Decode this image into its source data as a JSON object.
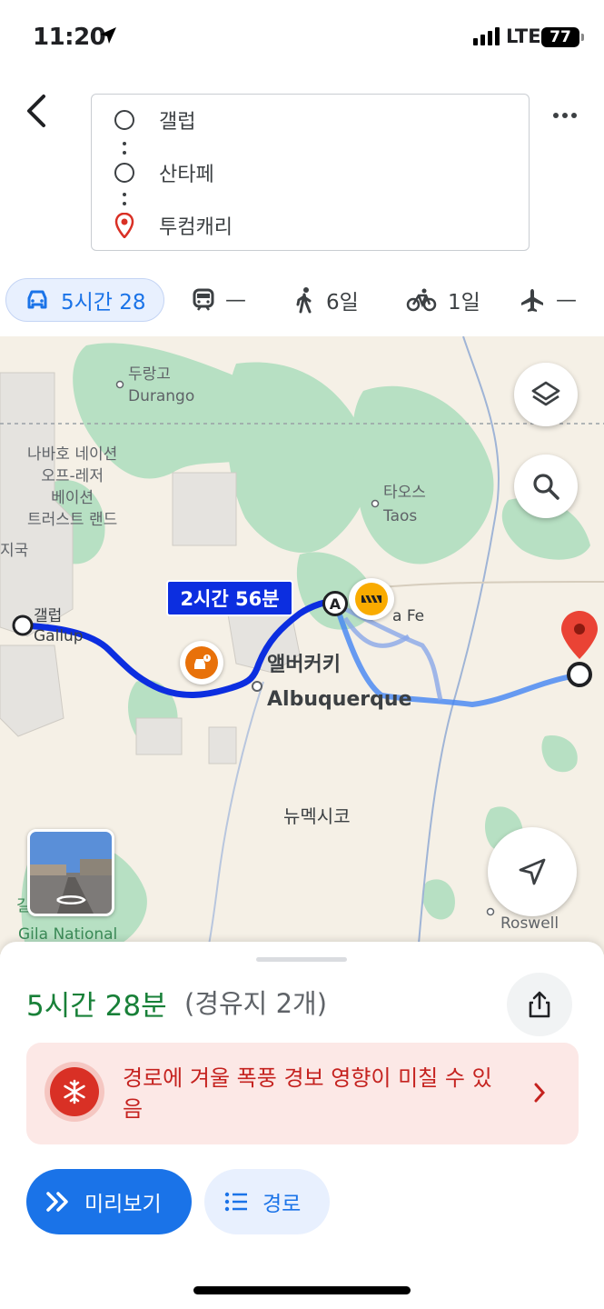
{
  "status_bar": {
    "time": "11:20",
    "network": "LTE",
    "battery": "77"
  },
  "header": {
    "back_icon": "chevron-left-icon",
    "stops": [
      {
        "label": "갤럽",
        "icon": "circle-icon"
      },
      {
        "label": "산타페",
        "icon": "circle-icon"
      },
      {
        "label": "투컴캐리",
        "icon": "pin-icon"
      }
    ],
    "more_icon": "more-horizontal-icon"
  },
  "modes": [
    {
      "name": "drive",
      "icon": "car-icon",
      "label": "5시간 28",
      "active": true
    },
    {
      "name": "transit",
      "icon": "train-icon",
      "label": "—"
    },
    {
      "name": "walk",
      "icon": "walk-icon",
      "label": "6일"
    },
    {
      "name": "bike",
      "icon": "bike-icon",
      "label": "1일"
    },
    {
      "name": "flight",
      "icon": "plane-icon",
      "label": "—"
    }
  ],
  "map": {
    "labels": {
      "durango_ko": "두랑고",
      "durango_en": "Durango",
      "navajo": "나바호 네이션\n오프-레저\n베이션\n트러스트 랜드",
      "partial_left": "지국",
      "taos_ko": "타오스",
      "taos_en": "Taos",
      "gallup_ko": "갤럽",
      "gallup_en": "Gallup",
      "santafe_partial": "a Fe",
      "albuquerque_ko": "앨버커키",
      "albuquerque_en": "Albuquerque",
      "new_mexico": "뉴멕시코",
      "gila_ko": "길라 국유림",
      "gila_en": "Gila National",
      "roswell": "Roswell"
    },
    "route_time": "2시간 56분",
    "waypoint_marker": "A"
  },
  "sheet": {
    "duration": "5시간 28분",
    "waypoints": "(경유지 2개)",
    "warning_text": "경로에 겨울 폭풍 경보 영향이 미칠 수 있음",
    "preview_label": "미리보기",
    "route_label": "경로"
  },
  "colors": {
    "accent": "#1a73e8",
    "route": "#0c2ee0",
    "alt_route": "#4285f4",
    "duration_green": "#188038",
    "warning_red": "#d93025",
    "map_green": "#a8dab5"
  }
}
